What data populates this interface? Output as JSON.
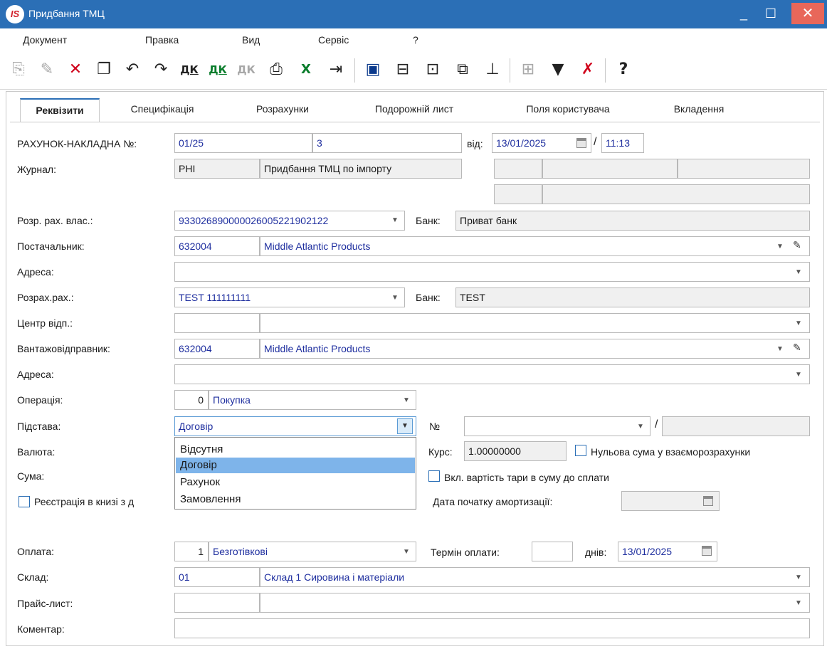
{
  "window": {
    "title": "Придбання ТМЦ",
    "logo": "IS",
    "min_glyph": "_",
    "max_glyph": "☐",
    "close_glyph": "✕"
  },
  "menu": [
    "Документ",
    "Правка",
    "Вид",
    "Сервіс",
    "?"
  ],
  "toolbar_icons": [
    "new-doc-icon",
    "edit-doc-icon",
    "delete-doc-icon",
    "copy-doc-icon",
    "return-icon",
    "return-2-icon",
    "dk-icon",
    "dk-2-icon",
    "dk-disabled-icon",
    "print-icon",
    "excel-icon",
    "exit-icon",
    "save-icon",
    "book-icon",
    "folder-icon",
    "link-icon",
    "tree-icon",
    "grid-icon",
    "filter-icon",
    "filter-clear-icon",
    "help-icon"
  ],
  "tabs": [
    "Реквізити",
    "Специфікація",
    "Розрахунки",
    "Подорожній лист",
    "Поля користувача",
    "Вкладення"
  ],
  "form": {
    "invoice_label": "РАХУНОК-НАКЛАДНА №:",
    "invoice_number": "01/25",
    "invoice_suffix": "3",
    "date_label": "від:",
    "date": "13/01/2025",
    "time_sep": "/",
    "time": "11:13",
    "journal_label": "Журнал:",
    "journal_code": "PHI",
    "journal_name": "Придбання ТМЦ по імпорту",
    "own_account_label": "Розр. рах. влас.:",
    "own_account": "933026890000026005221902122",
    "bank_label": "Банк:",
    "own_bank": "Приват банк",
    "supplier_label": "Постачальник:",
    "supplier_code": "632004",
    "supplier_name": "Middle Atlantic Products",
    "address_label": "Адреса:",
    "supplier_account_label": "Розрах.рах.:",
    "supplier_account": "TEST 111111111",
    "supplier_bank": "TEST",
    "center_label": "Центр відп.:",
    "shipper_label": "Вантажовідправник:",
    "shipper_code": "632004",
    "shipper_name": "Middle Atlantic Products",
    "operation_label": "Операція:",
    "operation_code": "0",
    "operation_name": "Покупка",
    "basis_label": "Підстава:",
    "basis_value": "Договір",
    "number_label": "№",
    "currency_label": "Валюта:",
    "rate_label": "Курс:",
    "rate_value": "1.00000000",
    "zero_sum_label": "Нульова сума у взаєморозрахунки",
    "sum_label": "Сума:",
    "tare_label": "Вкл. вартість тари в суму до сплати",
    "registry_label": "Реєстрація в книзі з д",
    "amort_label": "Дата початку амортизації:",
    "payment_label": "Оплата:",
    "payment_code": "1",
    "payment_name": "Безготівкові",
    "term_label": "Термін оплати:",
    "days_label": "днів:",
    "payment_date": "13/01/2025",
    "warehouse_label": "Склад:",
    "warehouse_code": "01",
    "warehouse_name": "Склад 1 Сировина і матеріали",
    "pricelist_label": "Прайс-лист:",
    "comment_label": "Коментар:"
  },
  "basis_options": [
    "Відсутня",
    "Договір",
    "Рахунок",
    "Замовлення"
  ],
  "basis_selected": "Договір",
  "colors": {
    "title_bar": "#2b6fb6",
    "field_text": "#1f2f9f",
    "selected_option": "#7eb4ea",
    "close_button": "#e8675a"
  }
}
